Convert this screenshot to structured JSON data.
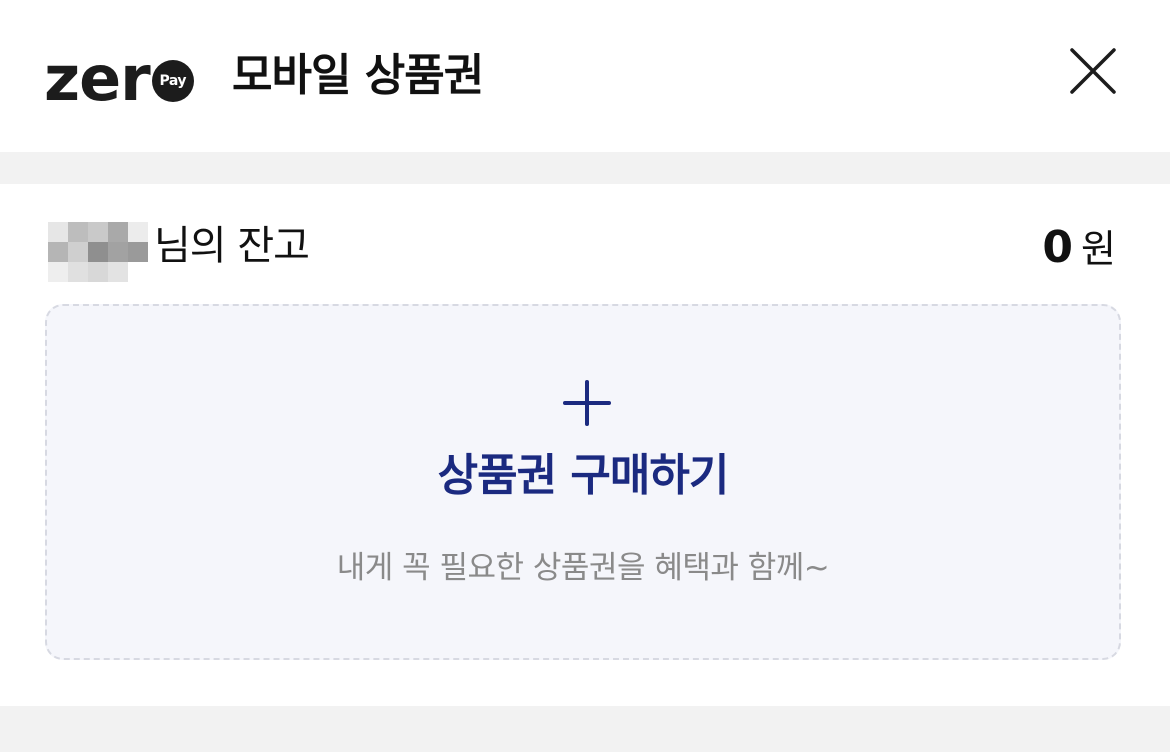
{
  "header": {
    "logo_text": "zer",
    "logo_badge": "Pay",
    "title": "모바일 상품권",
    "close_icon": "close-icon"
  },
  "balance": {
    "label": "님의 잔고",
    "amount": "0",
    "unit": "원"
  },
  "purchase": {
    "icon": "plus-icon",
    "title": "상품권 구매하기",
    "description": "내게 꼭 필요한 상품권을 혜택과 함께~"
  },
  "colors": {
    "accent": "#1b2a80",
    "card_bg": "#f5f6fb",
    "page_bg": "#f2f2f2",
    "muted_text": "#8a8a8a"
  }
}
